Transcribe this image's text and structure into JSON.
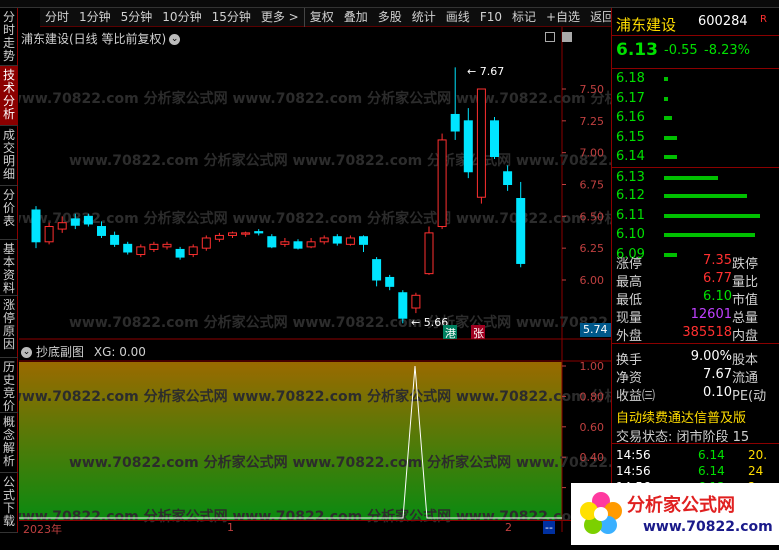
{
  "toolbar": {
    "items": [
      "分时",
      "1分钟",
      "5分钟",
      "10分钟",
      "15分钟",
      "更多 >",
      "复权",
      "叠加",
      "多股",
      "统计",
      "画线",
      "F10",
      "标记",
      "+自选",
      "返回"
    ]
  },
  "left_tabs": [
    {
      "label": "分时走势",
      "active": false
    },
    {
      "label": "技术分析",
      "active": true
    },
    {
      "label": "成交明细",
      "active": false
    },
    {
      "label": "分价表",
      "active": false
    },
    {
      "label": "基本资料",
      "active": false
    },
    {
      "label": "涨停原因",
      "active": false
    },
    {
      "label": "历史竞价",
      "active": false
    },
    {
      "label": "概念解析",
      "active": false
    },
    {
      "label": "公式下载",
      "active": false
    }
  ],
  "main_chart": {
    "title": "浦东建设(日线 等比前复权)",
    "price_axis": [
      "7.50",
      "7.25",
      "7.00",
      "6.75",
      "6.50",
      "6.25",
      "6.00"
    ],
    "high_label": "7.67",
    "low_label": "5.66",
    "current_marker": "5.74",
    "badge_1": "港",
    "badge_2": "张",
    "colors": {
      "up": "#ff3030",
      "down": "#00e5ff",
      "axis": "#c04040"
    }
  },
  "sub_chart": {
    "title": "抄底副图",
    "indicator": "XG: 0.00",
    "axis": [
      "1.00",
      "0.80",
      "0.60",
      "0.40",
      "0.20"
    ]
  },
  "time_axis": {
    "labels": [
      "2023年",
      "1",
      "2",
      "--"
    ]
  },
  "watermark": "www.70822.com 分析家公式网",
  "stock": {
    "name": "浦东建设",
    "code": "600284",
    "r": "R",
    "price": "6.13",
    "change": "-0.55",
    "pct": "-8.23%"
  },
  "order_book": [
    {
      "price": "6.18",
      "bar": 0.03
    },
    {
      "price": "6.17",
      "bar": 0.03
    },
    {
      "price": "6.16",
      "bar": 0.08
    },
    {
      "price": "6.15",
      "bar": 0.13
    },
    {
      "price": "6.14",
      "bar": 0.13
    },
    {
      "price": "6.13",
      "bar": 0.55
    },
    {
      "price": "6.12",
      "bar": 0.85
    },
    {
      "price": "6.11",
      "bar": 0.98
    },
    {
      "price": "6.10",
      "bar": 0.93
    },
    {
      "price": "6.09",
      "bar": 0.13
    }
  ],
  "stats": [
    {
      "label": "涨停",
      "value": "7.35",
      "color": "#ff3030",
      "label2": "跌停"
    },
    {
      "label": "最高",
      "value": "6.77",
      "color": "#ff3030",
      "label2": "量比"
    },
    {
      "label": "最低",
      "value": "6.10",
      "color": "#00e000",
      "label2": "市值"
    },
    {
      "label": "现量",
      "value": "12601",
      "color": "#c040ff",
      "label2": "总量"
    },
    {
      "label": "外盘",
      "value": "385518",
      "color": "#ff3030",
      "label2": "内盘"
    }
  ],
  "stats2": [
    {
      "label": "换手",
      "value": "9.00%",
      "color": "#ffffff",
      "label2": "股本"
    },
    {
      "label": "净资",
      "value": "7.67",
      "color": "#ffffff",
      "label2": "流通"
    },
    {
      "label": "收益㈢",
      "value": "0.10",
      "color": "#ffffff",
      "label2": "PE(动"
    }
  ],
  "marquee": "自动续费通达信普及版",
  "trade_state": "交易状态: 闭市阶段 15",
  "ticks": [
    {
      "time": "14:56",
      "price": "6.14",
      "vol": "20."
    },
    {
      "time": "14:56",
      "price": "6.14",
      "vol": "24"
    },
    {
      "time": "14:56",
      "price": "6.13",
      "vol": "2"
    }
  ],
  "logo": {
    "text": "分析家公式网",
    "url": "www.70822.com"
  }
}
